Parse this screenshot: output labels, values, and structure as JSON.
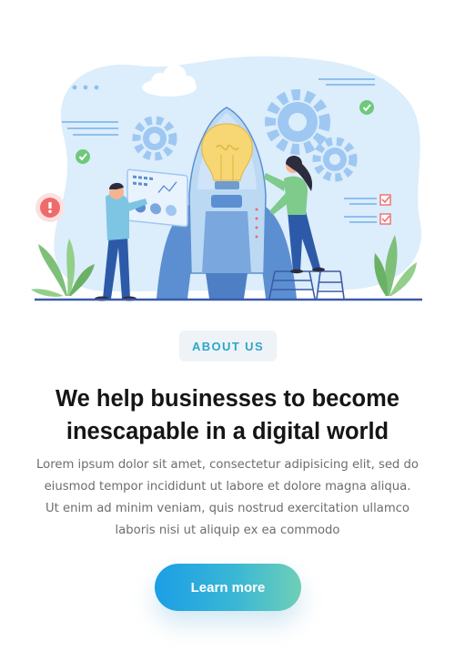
{
  "hero": {
    "illustration_icon": "rocket-lightbulb-team-illustration",
    "colors": {
      "blob": "#dcedfb",
      "rocket_body": "#bcd9f4",
      "rocket_dark": "#5b8fd1",
      "bulb": "#f7d774",
      "gear": "#9ec8f2",
      "check": "#6ec97a",
      "leaf": "#7ec07a",
      "ground": "#3b5bab"
    }
  },
  "badge": {
    "label": "ABOUT US"
  },
  "headline": {
    "line1": "We help businesses to become",
    "line2": "inescapable in a digital world"
  },
  "description": {
    "line1": "Lorem ipsum dolor sit amet, consectetur adipisicing elit, sed do",
    "line2": "eiusmod tempor incididunt ut labore et dolore magna aliqua.",
    "line3": "Ut enim ad minim veniam, quis nostrud exercitation ullamco",
    "line4": "laboris nisi ut aliquip ex ea commodo"
  },
  "cta": {
    "label": "Learn more"
  },
  "colors": {
    "accent": "#2fa5c9",
    "button_start": "#1b9ee6",
    "button_end": "#6fcfb7",
    "heading": "#151515",
    "body": "#6d6d6d"
  }
}
